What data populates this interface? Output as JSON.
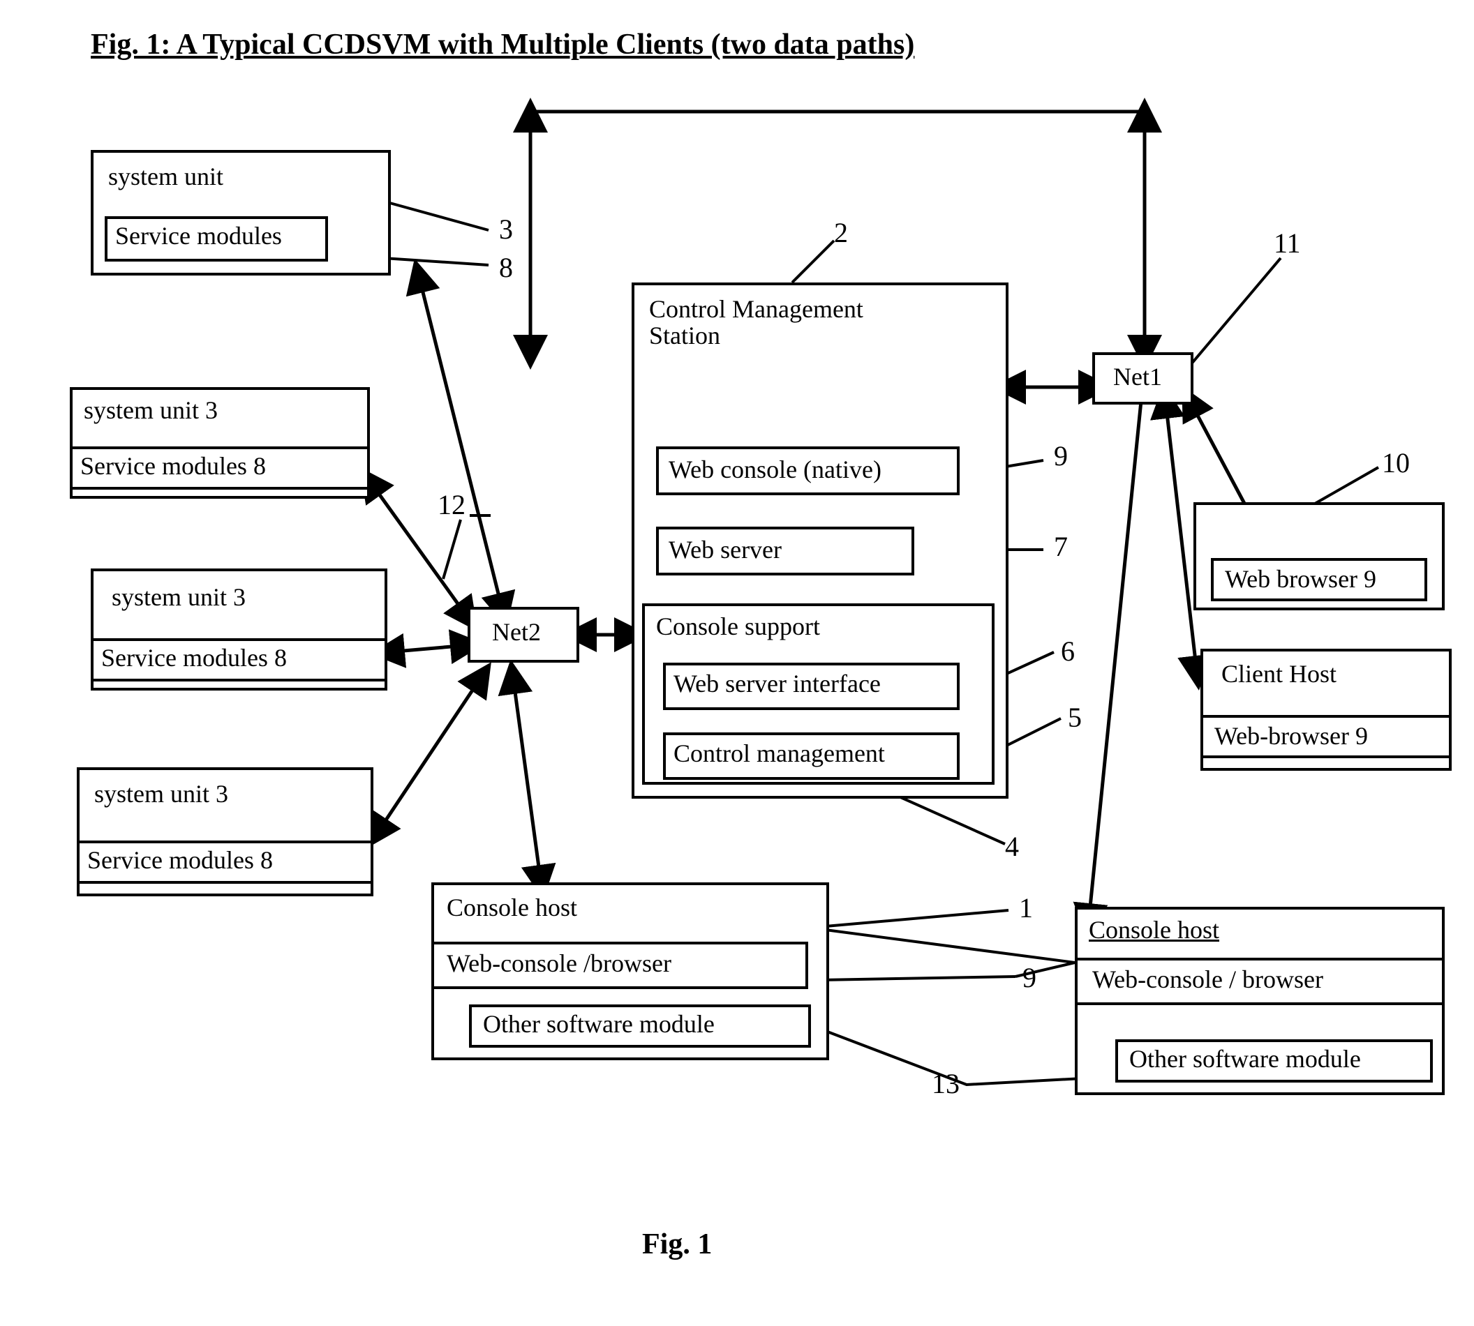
{
  "title": "Fig. 1: A Typical CCDSVM with Multiple Clients  (two data paths)",
  "caption": "Fig.  1",
  "system_units": [
    {
      "title": "system unit",
      "module": "Service modules"
    },
    {
      "title": "system unit 3",
      "module": "Service modules 8"
    },
    {
      "title": "system unit  3",
      "module": "Service modules  8"
    },
    {
      "title": "system unit  3",
      "module": "Service modules  8"
    }
  ],
  "cms": {
    "title": "Control Management\nStation",
    "web_console": "Web console (native)",
    "web_server": "Web server",
    "console_support": "Console support",
    "web_server_interface": "Web server interface",
    "control_management": "Control management"
  },
  "net1": "Net1",
  "net2": "Net2",
  "client_top": {
    "browser": "Web browser 9"
  },
  "client_host": {
    "title": "Client Host",
    "browser": "Web-browser  9"
  },
  "console_host_left": {
    "title": "Console host",
    "web_console": "Web-console /browser",
    "other": "Other software module"
  },
  "console_host_right": {
    "title": "Console host",
    "web_console": "Web-console / browser",
    "other": "Other software module"
  },
  "refs": {
    "n3": "3",
    "n8": "8",
    "n2": "2",
    "n11": "11",
    "n12": "12",
    "n9a": "9",
    "n7": "7",
    "n10": "10",
    "n6": "6",
    "n5": "5",
    "n4": "4",
    "n1": "1",
    "n9b": "9",
    "n13": "13"
  }
}
